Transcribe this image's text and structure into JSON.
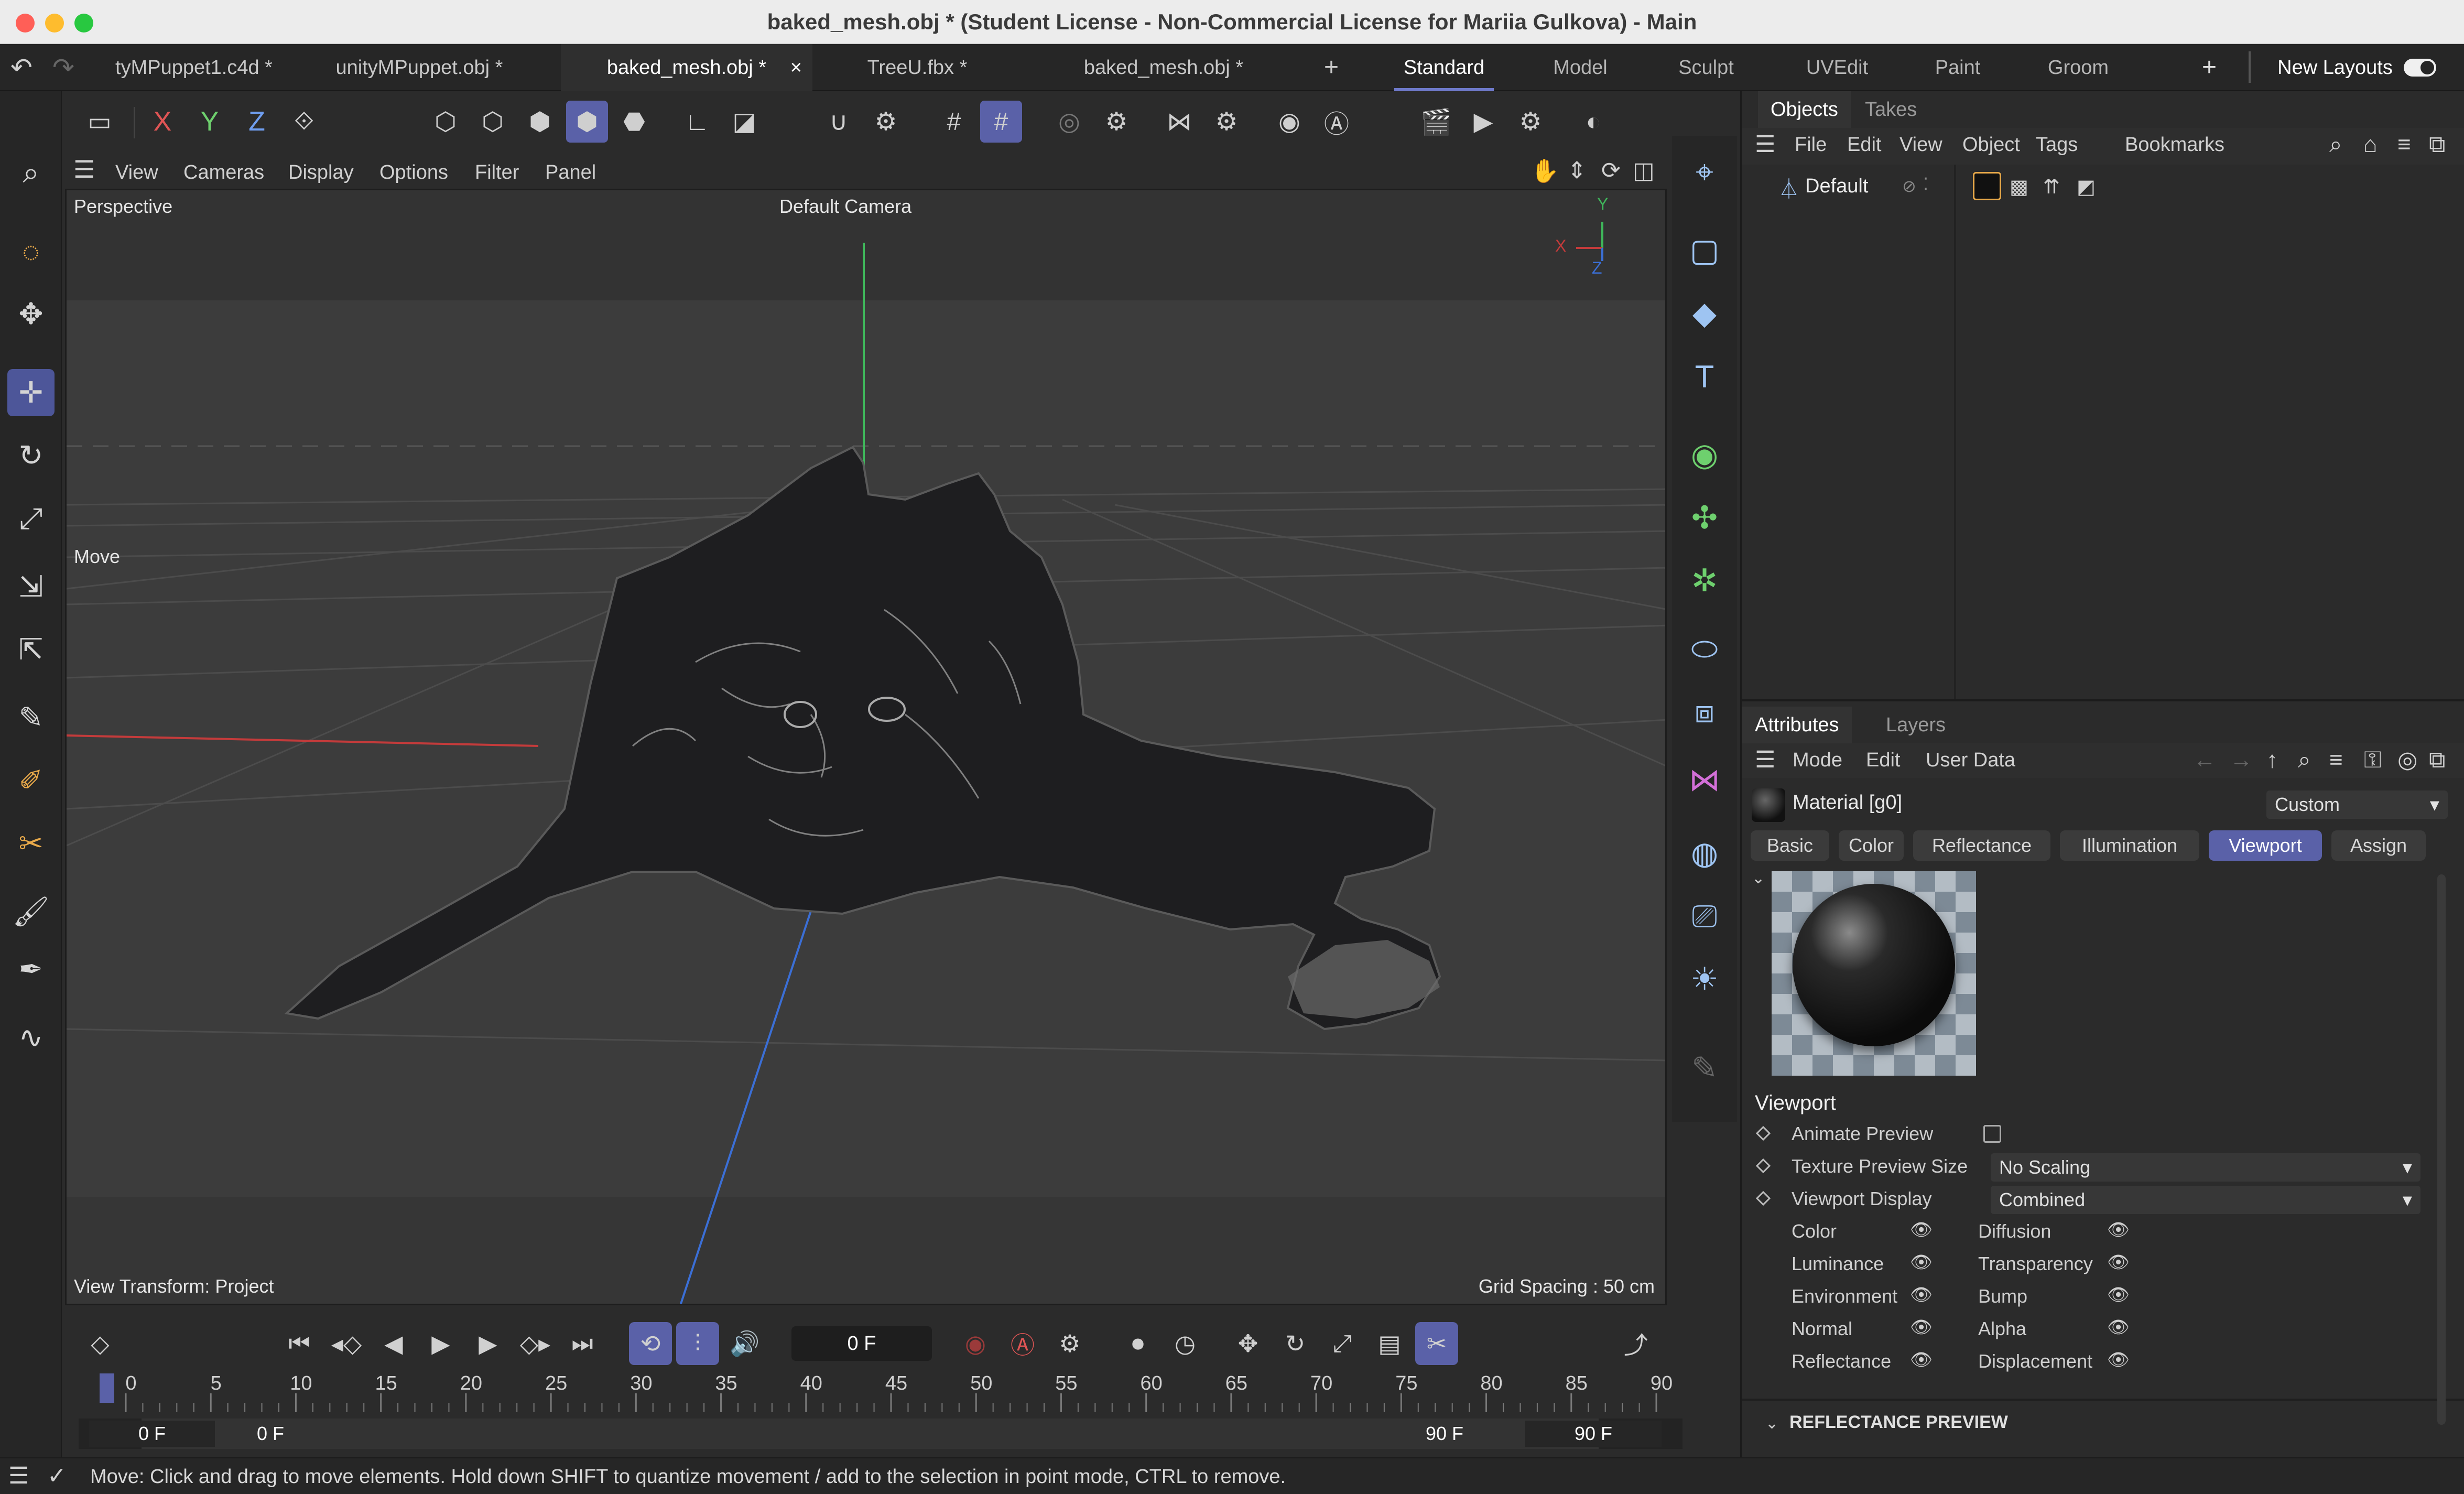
{
  "window": {
    "title": "baked_mesh.obj * (Student License - Non-Commercial License for Mariia Gulkova) - Main"
  },
  "doc_tabs": [
    "tyMPuppet1.c4d *",
    "unityMPuppet.obj *",
    "baked_mesh.obj *",
    "TreeU.fbx *",
    "baked_mesh.obj *"
  ],
  "layout_tabs": [
    "Standard",
    "Model",
    "Sculpt",
    "UVEdit",
    "Paint",
    "Groom"
  ],
  "new_layouts": "New Layouts",
  "add_tab": "+",
  "close_tab": "×",
  "toolbar": {
    "axis_x": "X",
    "axis_y": "Y",
    "axis_z": "Z"
  },
  "viewport_menu": [
    "View",
    "Cameras",
    "Display",
    "Options",
    "Filter",
    "Panel"
  ],
  "viewport": {
    "projection": "Perspective",
    "camera": "Default Camera",
    "tool_label": "Move",
    "view_transform": "View Transform: Project",
    "grid_spacing": "Grid Spacing : 50 cm",
    "axis_y": "Y",
    "axis_x": "X",
    "axis_z": "Z"
  },
  "timeline": {
    "current_frame": "0 F",
    "start_field": "0 F",
    "range_start": "0 F",
    "range_end": "90 F",
    "end_field": "90 F",
    "ticks": [
      "0",
      "5",
      "10",
      "15",
      "20",
      "25",
      "30",
      "35",
      "40",
      "45",
      "50",
      "55",
      "60",
      "65",
      "70",
      "75",
      "80",
      "85",
      "90"
    ]
  },
  "status_bar": {
    "text": "Move: Click and drag to move elements. Hold down SHIFT to quantize movement / add to the selection in point mode, CTRL to remove."
  },
  "objects_panel": {
    "tabs": [
      "Objects",
      "Takes"
    ],
    "menu": [
      "File",
      "Edit",
      "View",
      "Object",
      "Tags",
      "Bookmarks"
    ],
    "items": [
      {
        "name": "Default"
      }
    ]
  },
  "attributes_panel": {
    "tabs": [
      "Attributes",
      "Layers"
    ],
    "menu": [
      "Mode",
      "Edit",
      "User Data"
    ],
    "material_name": "Material [g0]",
    "preset": "Custom",
    "mat_tabs": [
      "Basic",
      "Color",
      "Reflectance",
      "Illumination",
      "Viewport",
      "Assign"
    ],
    "section_title": "Viewport",
    "rows": {
      "animate_preview": "Animate Preview",
      "texture_preview_size": "Texture Preview Size",
      "texture_preview_value": "No Scaling",
      "viewport_display": "Viewport Display",
      "viewport_display_value": "Combined"
    },
    "channels_left": [
      "Color",
      "Luminance",
      "Environment",
      "Normal",
      "Reflectance"
    ],
    "channels_right": [
      "Diffusion",
      "Transparency",
      "Bump",
      "Alpha",
      "Displacement"
    ],
    "reflectance_preview": "REFLECTANCE PREVIEW"
  },
  "colors": {
    "accent": "#5a61a8",
    "x_axis": "#c43b3b",
    "y_axis": "#3fb85b",
    "z_axis": "#3b6fd6"
  }
}
